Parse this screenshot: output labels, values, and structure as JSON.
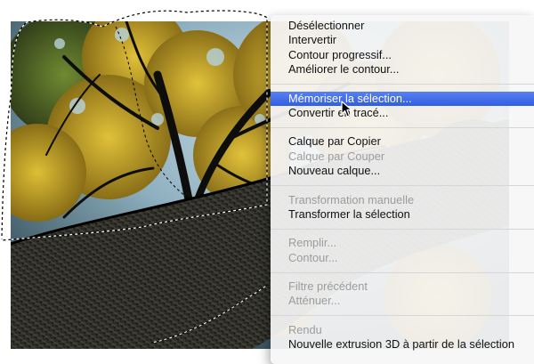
{
  "menu": {
    "groups": [
      {
        "items": [
          {
            "label": "Désélectionner",
            "enabled": true
          },
          {
            "label": "Intervertir",
            "enabled": true
          },
          {
            "label": "Contour progressif...",
            "enabled": true
          },
          {
            "label": "Améliorer le contour...",
            "enabled": true
          }
        ]
      },
      {
        "items": [
          {
            "label": "Mémoriser la sélection...",
            "enabled": true,
            "highlighted": true
          },
          {
            "label": "Convertir en tracé...",
            "enabled": true
          }
        ]
      },
      {
        "items": [
          {
            "label": "Calque par Copier",
            "enabled": true
          },
          {
            "label": "Calque par Couper",
            "enabled": false
          },
          {
            "label": "Nouveau calque...",
            "enabled": true
          }
        ]
      },
      {
        "items": [
          {
            "label": "Transformation manuelle",
            "enabled": false
          },
          {
            "label": "Transformer la sélection",
            "enabled": true
          }
        ]
      },
      {
        "items": [
          {
            "label": "Remplir...",
            "enabled": false
          },
          {
            "label": "Contour...",
            "enabled": false
          }
        ]
      },
      {
        "items": [
          {
            "label": "Filtre précédent",
            "enabled": false
          },
          {
            "label": "Atténuer...",
            "enabled": false
          }
        ]
      },
      {
        "items": [
          {
            "label": "Rendu",
            "enabled": false
          },
          {
            "label": "Nouvelle extrusion 3D à partir de la sélection",
            "enabled": true
          }
        ]
      }
    ]
  },
  "colors": {
    "highlight": "#3f6ae8",
    "disabled_text": "#9c9c9c",
    "foliage": "#c9a21a",
    "trunk": "#0e0e0c"
  }
}
